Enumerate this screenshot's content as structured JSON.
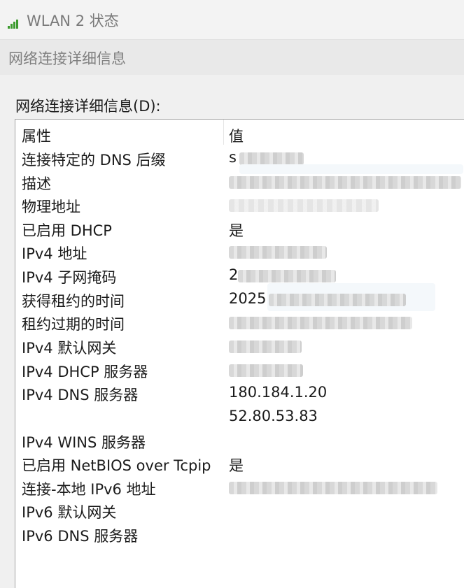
{
  "window": {
    "title": "WLAN 2 状态"
  },
  "section_title": "网络连接详细信息",
  "list_label": "网络连接详细信息(D):",
  "columns": {
    "property": "属性",
    "value": "值"
  },
  "rows": [
    {
      "property": "连接特定的 DNS 后缀",
      "value": "s"
    },
    {
      "property": "描述",
      "value": ""
    },
    {
      "property": "物理地址",
      "value": ""
    },
    {
      "property": "已启用 DHCP",
      "value": "是"
    },
    {
      "property": "IPv4 地址",
      "value": ""
    },
    {
      "property": "IPv4 子网掩码",
      "value": "2"
    },
    {
      "property": "获得租约的时间",
      "value": "2025"
    },
    {
      "property": "租约过期的时间",
      "value": ""
    },
    {
      "property": "IPv4 默认网关",
      "value": ""
    },
    {
      "property": "IPv4 DHCP 服务器",
      "value": ""
    },
    {
      "property": "IPv4 DNS 服务器",
      "value": "180.184.1.20"
    },
    {
      "property": "",
      "value": "52.80.53.83"
    },
    {
      "property": "IPv4 WINS 服务器",
      "value": ""
    },
    {
      "property": "已启用 NetBIOS over Tcpip",
      "value": "是"
    },
    {
      "property": "连接-本地 IPv6 地址",
      "value": ""
    },
    {
      "property": "IPv6 默认网关",
      "value": ""
    },
    {
      "property": "IPv6 DNS 服务器",
      "value": ""
    }
  ],
  "icons": {
    "title_icon": "wifi-signal-icon"
  },
  "colors": {
    "signal_green": "#3c9a2e"
  }
}
